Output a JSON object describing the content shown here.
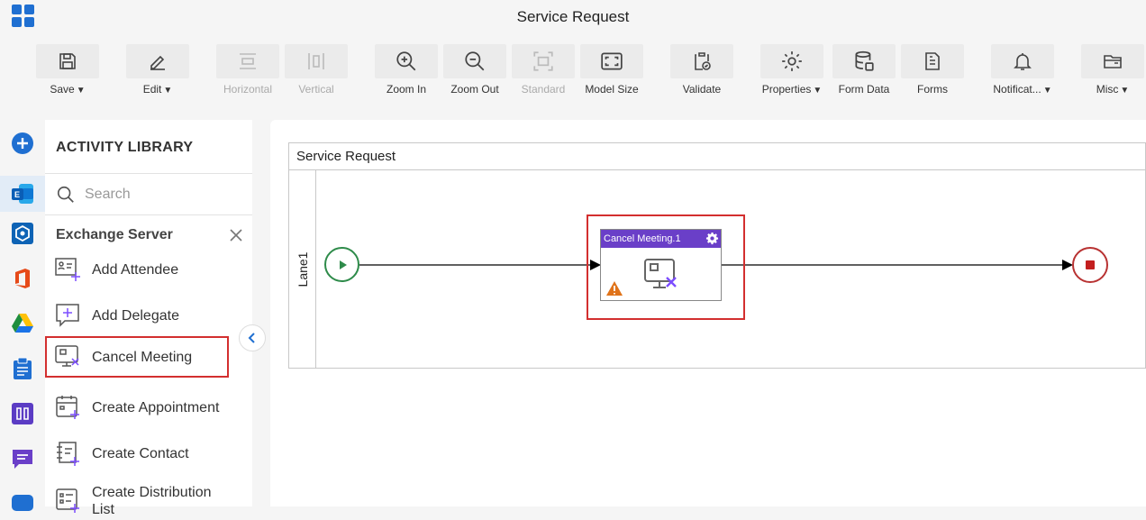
{
  "app": {
    "title": "Service Request"
  },
  "toolbar": {
    "save": "Save",
    "edit": "Edit",
    "horizontal": "Horizontal",
    "vertical": "Vertical",
    "zoom_in": "Zoom In",
    "zoom_out": "Zoom Out",
    "standard": "Standard",
    "model_size": "Model Size",
    "validate": "Validate",
    "properties": "Properties",
    "form_data": "Form Data",
    "forms": "Forms",
    "notifications": "Notificat...",
    "misc": "Misc"
  },
  "library": {
    "title": "ACTIVITY LIBRARY",
    "search_placeholder": "Search",
    "category": "Exchange Server",
    "items": [
      {
        "label": "Add Attendee",
        "icon": "add-attendee-icon"
      },
      {
        "label": "Add Delegate",
        "icon": "add-delegate-icon"
      },
      {
        "label": "Cancel Meeting",
        "icon": "cancel-meeting-icon"
      },
      {
        "label": "Create Appointment",
        "icon": "create-appointment-icon"
      },
      {
        "label": "Create Contact",
        "icon": "create-contact-icon"
      },
      {
        "label": "Create Distribution List",
        "icon": "create-distribution-list-icon"
      }
    ]
  },
  "diagram": {
    "pool_title": "Service Request",
    "lane_label": "Lane1",
    "task_label": "Cancel Meeting.1"
  },
  "colors": {
    "accent_blue": "#1f6fd1",
    "task_header": "#6a3fc8",
    "selection": "#d32f2f",
    "start_green": "#2e8b4a",
    "end_red": "#c31f1f"
  }
}
